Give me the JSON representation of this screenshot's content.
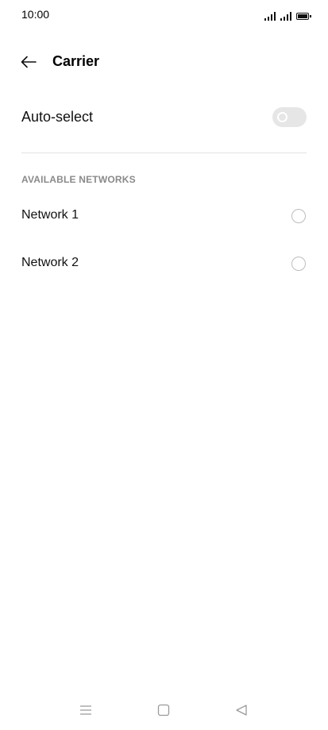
{
  "status_bar": {
    "time": "10:00",
    "icons": [
      "signal-1-icon",
      "signal-2-icon",
      "battery-icon"
    ]
  },
  "header": {
    "back_icon": "arrow-left-icon",
    "title": "Carrier"
  },
  "auto_select": {
    "label": "Auto-select",
    "enabled": false
  },
  "available_networks": {
    "section_title": "AVAILABLE NETWORKS",
    "items": [
      {
        "label": "Network 1",
        "selected": false
      },
      {
        "label": "Network 2",
        "selected": false
      }
    ]
  },
  "nav_bar": {
    "buttons": [
      "menu-icon",
      "home-icon",
      "back-triangle-icon"
    ]
  },
  "colors": {
    "background": "#ffffff",
    "section_title": "#8a8a8a",
    "toggle_off": "#e6e6e6",
    "radio_border": "#bdbdbd",
    "divider": "#e3e3e3"
  }
}
